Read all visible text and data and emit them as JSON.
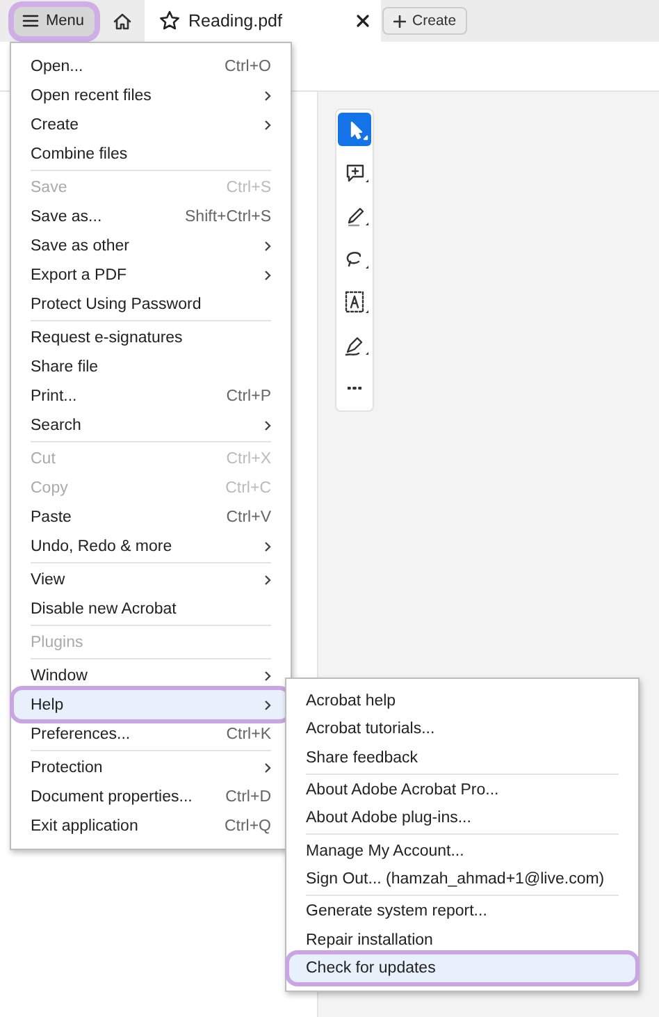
{
  "tab_bar": {
    "menu_button": {
      "label": "Menu",
      "annotated": true
    },
    "document_tab": {
      "title": "Reading.pdf",
      "selected": true
    },
    "create_button": {
      "label": "Create"
    }
  },
  "tools": [
    {
      "kind": "select",
      "selected": true
    },
    {
      "kind": "comment",
      "selected": false
    },
    {
      "kind": "draw",
      "selected": false
    },
    {
      "kind": "lasso",
      "selected": false
    },
    {
      "kind": "text",
      "selected": false
    },
    {
      "kind": "sign",
      "selected": false
    },
    {
      "kind": "more",
      "selected": false
    }
  ],
  "main_menu": {
    "groups": [
      [
        {
          "label": "Open...",
          "shortcut": "Ctrl+O",
          "submenu": false,
          "disabled": false,
          "selected": false,
          "annotated": false
        },
        {
          "label": "Open recent files",
          "submenu": true,
          "disabled": false,
          "selected": false,
          "annotated": false
        },
        {
          "label": "Create",
          "submenu": true,
          "disabled": false,
          "selected": false,
          "annotated": false
        },
        {
          "label": "Combine files",
          "submenu": false,
          "disabled": false,
          "selected": false,
          "annotated": false
        }
      ],
      [
        {
          "label": "Save",
          "shortcut": "Ctrl+S",
          "submenu": false,
          "disabled": true,
          "selected": false,
          "annotated": false
        },
        {
          "label": "Save as...",
          "shortcut": "Shift+Ctrl+S",
          "submenu": false,
          "disabled": false,
          "selected": false,
          "annotated": false
        },
        {
          "label": "Save as other",
          "submenu": true,
          "disabled": false,
          "selected": false,
          "annotated": false
        },
        {
          "label": "Export a PDF",
          "submenu": true,
          "disabled": false,
          "selected": false,
          "annotated": false
        },
        {
          "label": "Protect Using Password",
          "submenu": false,
          "disabled": false,
          "selected": false,
          "annotated": false
        }
      ],
      [
        {
          "label": "Request e-signatures",
          "submenu": false,
          "disabled": false,
          "selected": false,
          "annotated": false
        },
        {
          "label": "Share file",
          "submenu": false,
          "disabled": false,
          "selected": false,
          "annotated": false
        },
        {
          "label": "Print...",
          "shortcut": "Ctrl+P",
          "submenu": false,
          "disabled": false,
          "selected": false,
          "annotated": false
        },
        {
          "label": "Search",
          "submenu": true,
          "disabled": false,
          "selected": false,
          "annotated": false
        }
      ],
      [
        {
          "label": "Cut",
          "shortcut": "Ctrl+X",
          "submenu": false,
          "disabled": true,
          "selected": false,
          "annotated": false
        },
        {
          "label": "Copy",
          "shortcut": "Ctrl+C",
          "submenu": false,
          "disabled": true,
          "selected": false,
          "annotated": false
        },
        {
          "label": "Paste",
          "shortcut": "Ctrl+V",
          "submenu": false,
          "disabled": false,
          "selected": false,
          "annotated": false
        },
        {
          "label": "Undo, Redo & more",
          "submenu": true,
          "disabled": false,
          "selected": false,
          "annotated": false
        }
      ],
      [
        {
          "label": "View",
          "submenu": true,
          "disabled": false,
          "selected": false,
          "annotated": false
        },
        {
          "label": "Disable new Acrobat",
          "submenu": false,
          "disabled": false,
          "selected": false,
          "annotated": false
        }
      ],
      [
        {
          "label": "Plugins",
          "submenu": false,
          "disabled": true,
          "selected": false,
          "annotated": false
        }
      ],
      [
        {
          "label": "Window",
          "submenu": true,
          "disabled": false,
          "selected": false,
          "annotated": false
        },
        {
          "label": "Help",
          "submenu": true,
          "disabled": false,
          "selected": true,
          "annotated": true
        },
        {
          "label": "Preferences...",
          "shortcut": "Ctrl+K",
          "submenu": false,
          "disabled": false,
          "selected": false,
          "annotated": false
        }
      ],
      [
        {
          "label": "Protection",
          "submenu": true,
          "disabled": false,
          "selected": false,
          "annotated": false
        },
        {
          "label": "Document properties...",
          "shortcut": "Ctrl+D",
          "submenu": false,
          "disabled": false,
          "selected": false,
          "annotated": false
        },
        {
          "label": "Exit application",
          "shortcut": "Ctrl+Q",
          "submenu": false,
          "disabled": false,
          "selected": false,
          "annotated": false
        }
      ]
    ]
  },
  "help_submenu": {
    "groups": [
      [
        {
          "label": "Acrobat help",
          "submenu": false,
          "disabled": false,
          "selected": false,
          "annotated": false
        },
        {
          "label": "Acrobat tutorials...",
          "submenu": false,
          "disabled": false,
          "selected": false,
          "annotated": false
        },
        {
          "label": "Share feedback",
          "submenu": false,
          "disabled": false,
          "selected": false,
          "annotated": false
        }
      ],
      [
        {
          "label": "About Adobe Acrobat Pro...",
          "submenu": false,
          "disabled": false,
          "selected": false,
          "annotated": false
        },
        {
          "label": "About Adobe plug-ins...",
          "submenu": false,
          "disabled": false,
          "selected": false,
          "annotated": false
        }
      ],
      [
        {
          "label": "Manage My Account...",
          "submenu": false,
          "disabled": false,
          "selected": false,
          "annotated": false
        },
        {
          "label": "Sign Out... (hamzah_ahmad+1@live.com)",
          "submenu": false,
          "disabled": false,
          "selected": false,
          "annotated": false
        }
      ],
      [
        {
          "label": "Generate system report...",
          "submenu": false,
          "disabled": false,
          "selected": false,
          "annotated": false
        },
        {
          "label": "Repair installation",
          "submenu": false,
          "disabled": false,
          "selected": false,
          "annotated": false
        },
        {
          "label": "Check for updates",
          "submenu": false,
          "disabled": false,
          "selected": true,
          "annotated": true
        }
      ]
    ]
  }
}
